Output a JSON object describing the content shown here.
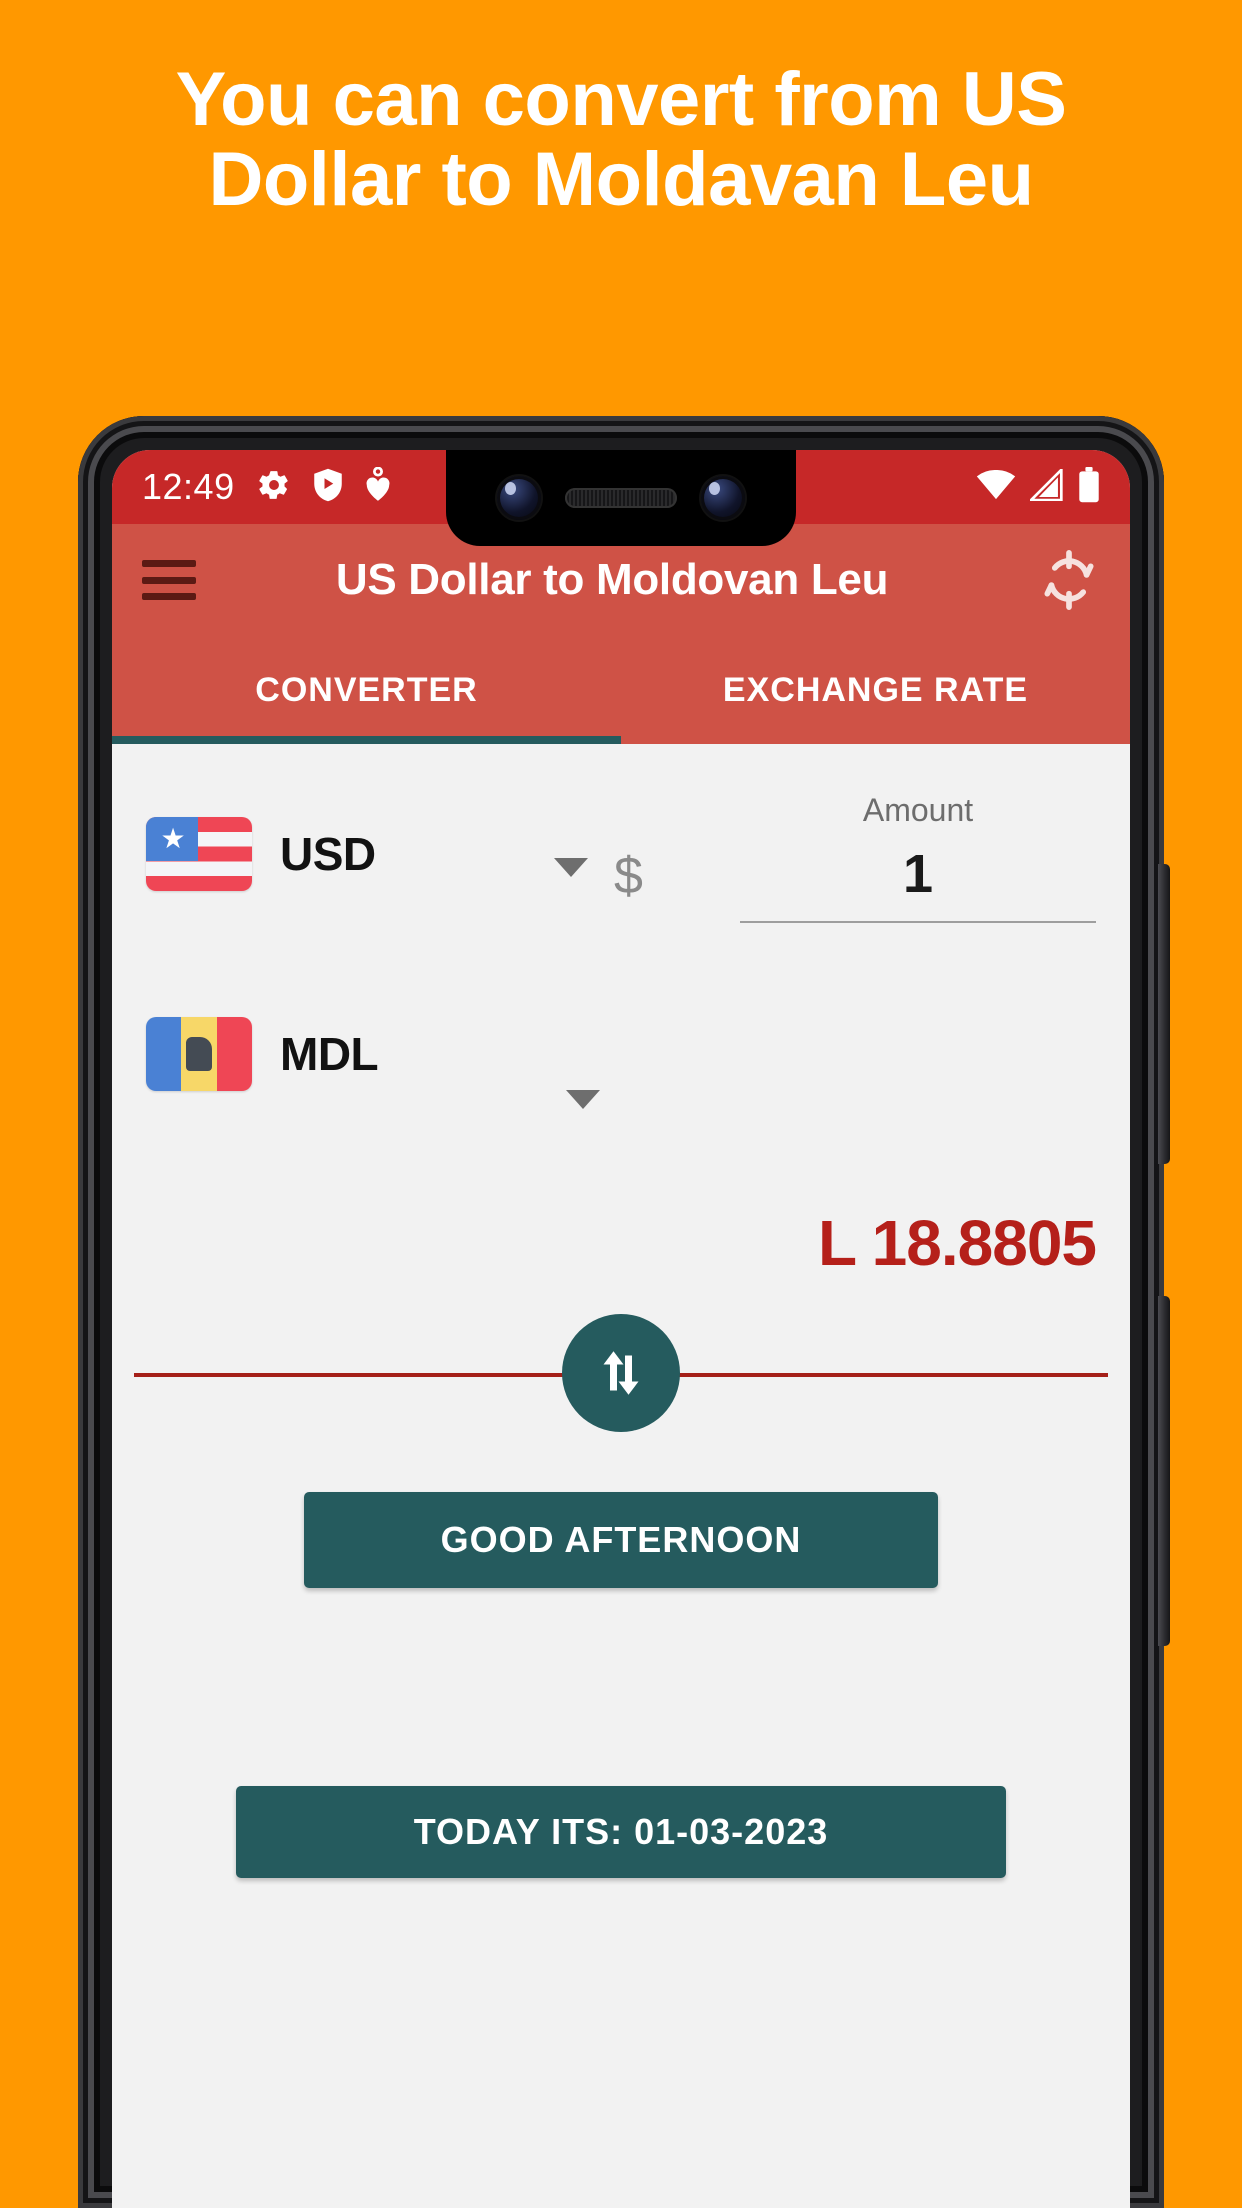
{
  "promo": {
    "headline": "You can convert from US Dollar to Moldavan Leu",
    "background_color": "#ff9800",
    "text_color": "#ffffff"
  },
  "statusbar": {
    "time": "12:49",
    "left_icons": [
      "gear-icon",
      "shield-play-icon",
      "heart-pin-icon"
    ],
    "right_icons": [
      "wifi-icon",
      "cell-signal-icon",
      "battery-icon"
    ],
    "background_color": "#c62828"
  },
  "appbar": {
    "menu_icon": "hamburger-menu-icon",
    "title": "US Dollar to Moldovan Leu",
    "refresh_icon": "refresh-sync-icon",
    "background_color": "#cf5246"
  },
  "tabs": {
    "items": [
      {
        "label": "CONVERTER",
        "active": true
      },
      {
        "label": "EXCHANGE RATE",
        "active": false
      }
    ],
    "indicator_color": "#255b5e"
  },
  "converter": {
    "from": {
      "flag": "us-flag-icon",
      "code": "USD",
      "symbol": "$"
    },
    "amount": {
      "label": "Amount",
      "value": "1",
      "placeholder": "Amount"
    },
    "to": {
      "flag": "moldova-flag-icon",
      "code": "MDL"
    },
    "result": "L 18.8805",
    "result_color": "#b5201a",
    "swap_icon": "swap-vertical-arrows-icon",
    "divider_color": "#a52019"
  },
  "actions": {
    "greeting_label": "GOOD AFTERNOON",
    "today_label": "TODAY ITS: 01-03-2023",
    "button_color": "#255b5e"
  }
}
